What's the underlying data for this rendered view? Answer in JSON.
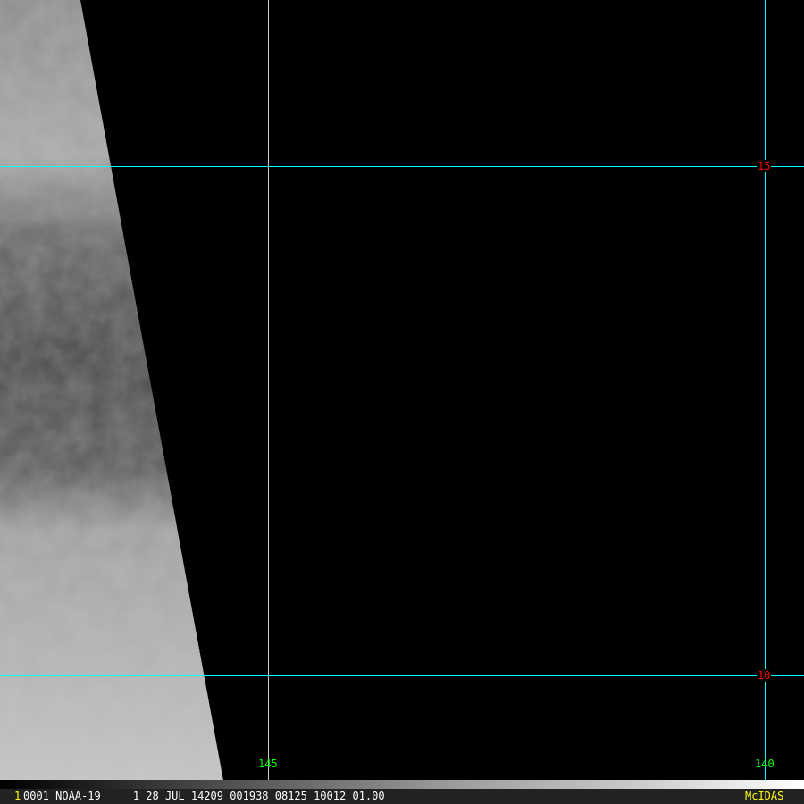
{
  "image": {
    "satellite": "NOAA-19",
    "latitude_labels": [
      "15",
      "10"
    ],
    "longitude_labels": [
      "145",
      "140"
    ],
    "grid_color": "#00ffff",
    "lat_label_color": "#ff0000",
    "lon_label_color": "#00ff00"
  },
  "status_bar": {
    "frame_number": "1",
    "info": "0001 NOAA-19     1 28 JUL 14209 001938 08125 10012 01.00",
    "brand": "McIDAS"
  }
}
